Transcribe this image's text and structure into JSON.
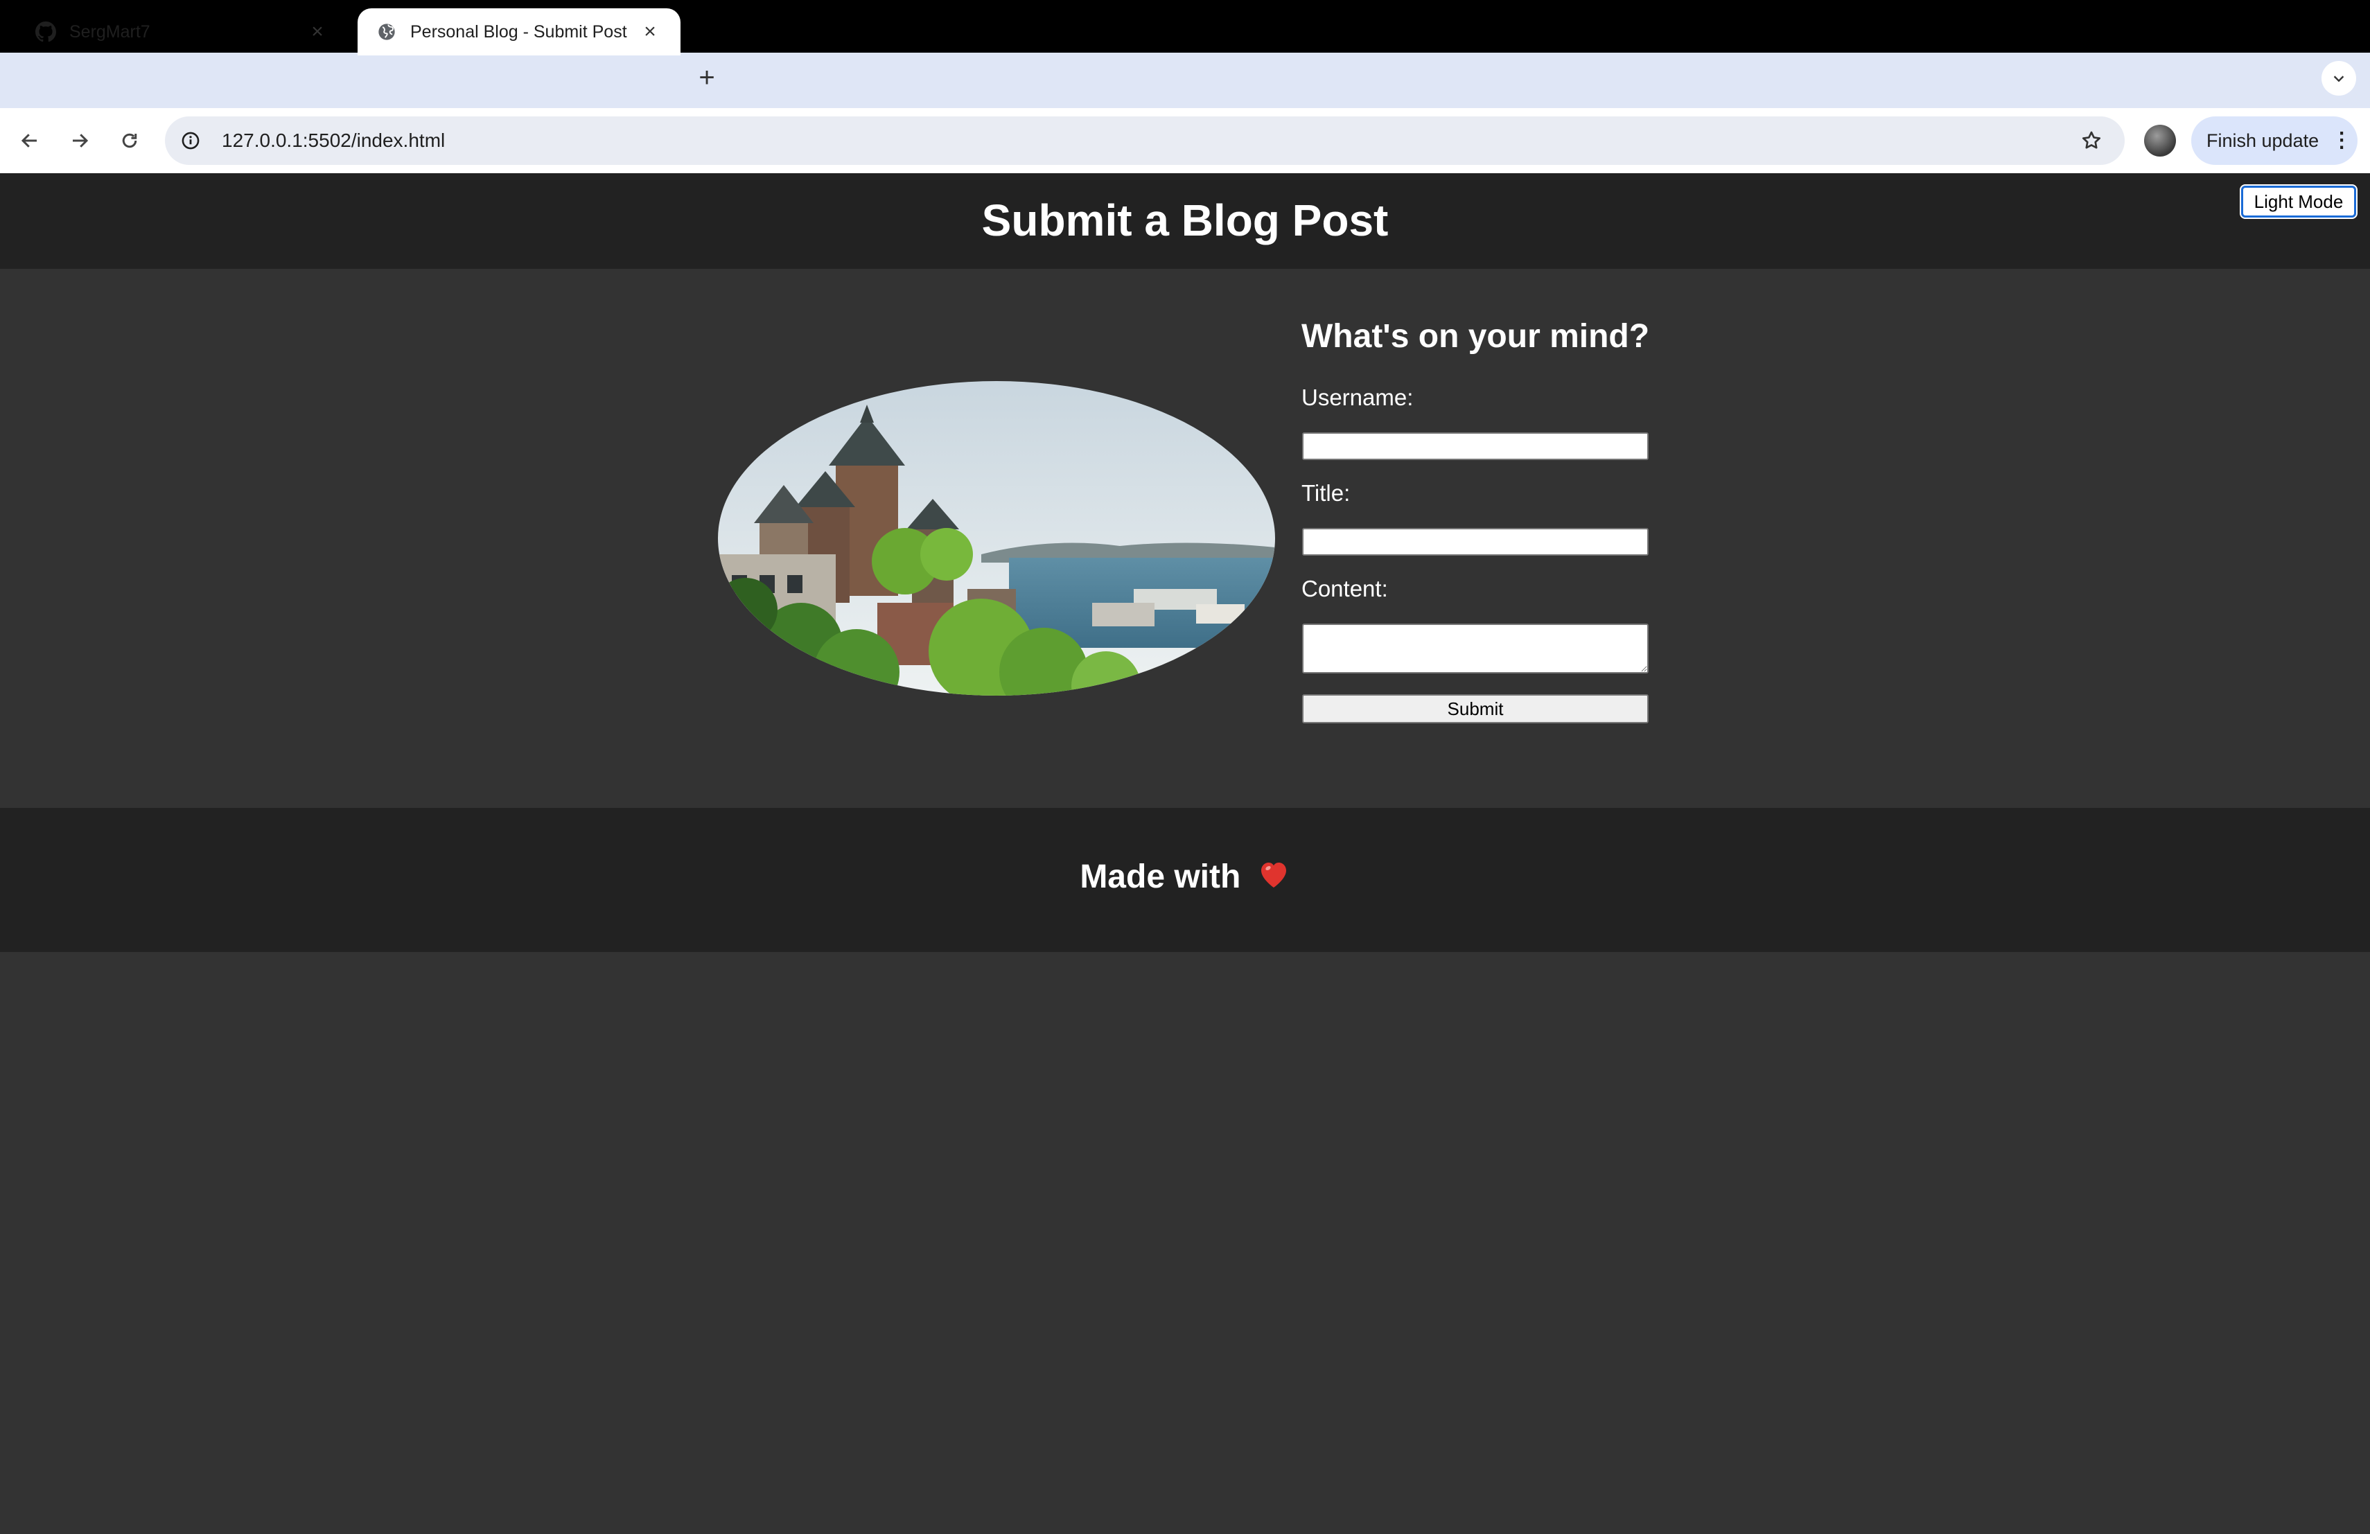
{
  "browser": {
    "tabs": [
      {
        "title": "SergMart7",
        "favicon": "github-icon",
        "active": false
      },
      {
        "title": "Personal Blog - Submit Post",
        "favicon": "globe-icon",
        "active": true
      }
    ],
    "url": "127.0.0.1:5502/index.html",
    "update_label": "Finish update"
  },
  "header": {
    "title": "Submit a Blog Post",
    "mode_toggle_label": "Light Mode"
  },
  "main": {
    "image": {
      "subject": "city-skyline-photo"
    },
    "form": {
      "heading": "What's on your mind?",
      "username_label": "Username:",
      "title_label": "Title:",
      "content_label": "Content:",
      "username_value": "",
      "title_value": "",
      "content_value": "",
      "submit_label": "Submit"
    }
  },
  "footer": {
    "text": "Made with"
  },
  "colors": {
    "page_bg": "#333333",
    "header_bg": "#222222",
    "footer_bg": "#222222",
    "heart": "#e0342e"
  }
}
